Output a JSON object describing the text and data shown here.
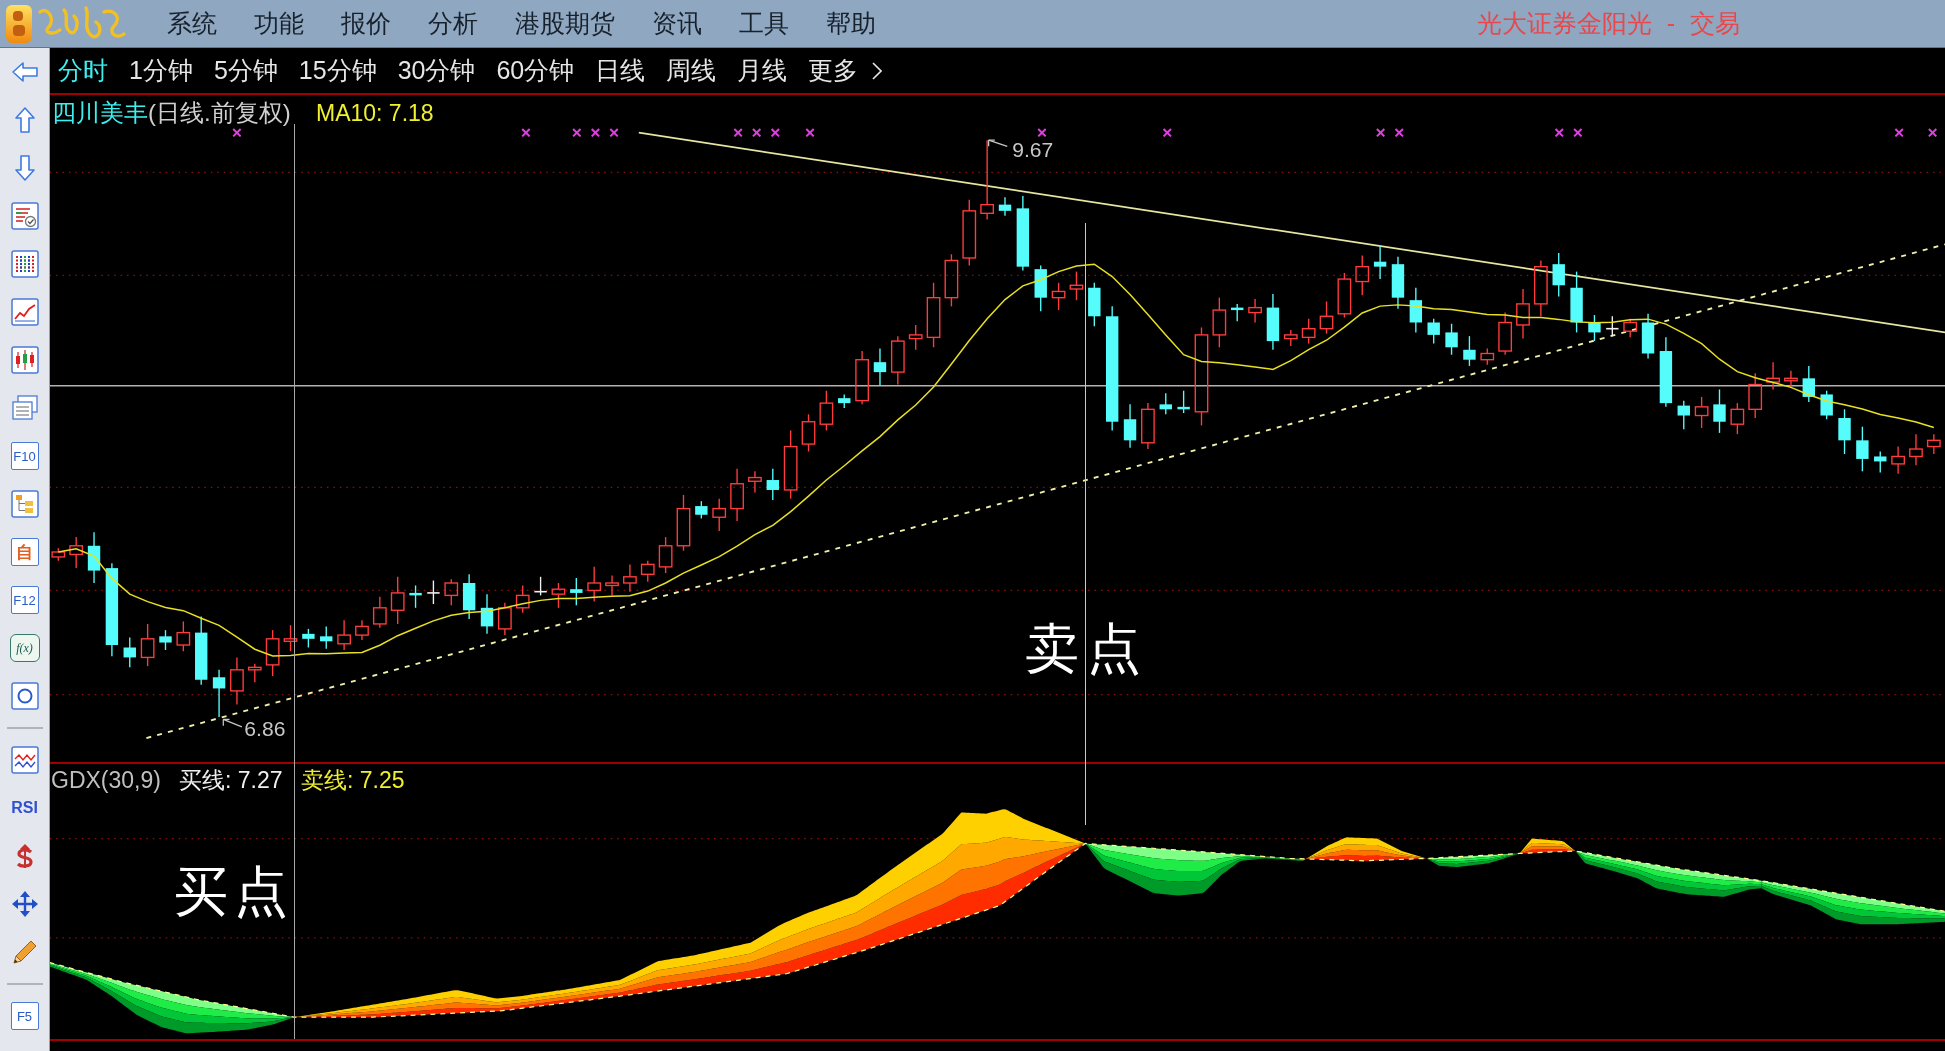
{
  "menu_bar": {
    "items": [
      "系统",
      "功能",
      "报价",
      "分析",
      "港股期货",
      "资讯",
      "工具",
      "帮助"
    ],
    "title": "光大证券金阳光 - 交易"
  },
  "toolbar": {
    "labels": [
      "F10",
      "自",
      "F12",
      "f(x)",
      "RSI",
      "F5"
    ]
  },
  "periods": [
    {
      "label": "分时",
      "selected": true
    },
    {
      "label": "1分钟",
      "selected": false
    },
    {
      "label": "5分钟",
      "selected": false
    },
    {
      "label": "15分钟",
      "selected": false
    },
    {
      "label": "30分钟",
      "selected": false
    },
    {
      "label": "60分钟",
      "selected": false
    },
    {
      "label": "日线",
      "selected": false
    },
    {
      "label": "周线",
      "selected": false
    },
    {
      "label": "月线",
      "selected": false
    }
  ],
  "more": "更多",
  "price_chart": {
    "stock": "四川美丰",
    "mode": "(日线.前复权)",
    "ma": "MA10: 7.18",
    "high_label": "9.67",
    "low_label": "6.86",
    "annotation": "卖点"
  },
  "indicator": {
    "name": "GDX(30,9)",
    "buy_line": "买线: 7.27",
    "sell_line": "卖线: 7.25",
    "annotation": "买点"
  }
}
